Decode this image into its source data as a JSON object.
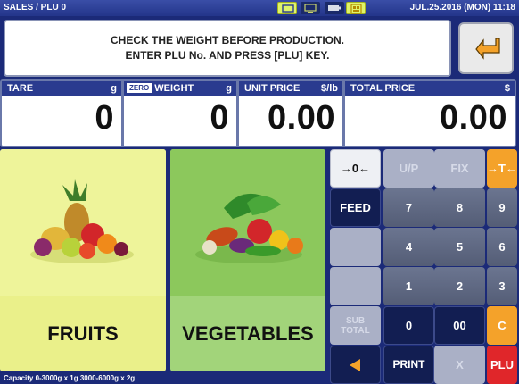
{
  "topbar": {
    "mode": "SALES / PLU 0",
    "datetime": "JUL.25.2016 (MON) 11:18",
    "status_icons": [
      "display-mode-icon",
      "monitor-icon",
      "battery-icon",
      "keypad-icon"
    ]
  },
  "message": {
    "line1": "CHECK THE WEIGHT BEFORE PRODUCTION.",
    "line2": "ENTER PLU No. AND PRESS [PLU] KEY."
  },
  "display": {
    "tare": {
      "label": "TARE",
      "unit": "g",
      "value": "0"
    },
    "weight": {
      "badge": "ZERO",
      "label": "WEIGHT",
      "unit": "g",
      "value": "0"
    },
    "unit_price": {
      "label": "UNIT PRICE",
      "unit": "$/lb",
      "value": "0.00"
    },
    "total_price": {
      "label": "TOTAL PRICE",
      "unit": "$",
      "value": "0.00"
    }
  },
  "categories": {
    "fruits": "FRUITS",
    "vegetables": "VEGETABLES"
  },
  "keys": {
    "zero": "→0←",
    "up": "U/P",
    "fix": "FIX",
    "tare": "→T←",
    "feed": "FEED",
    "sub_total": "SUB TOTAL",
    "print": "PRINT",
    "x": "X",
    "plu": "PLU",
    "clear": "C",
    "n0": "0",
    "n00": "00",
    "n1": "1",
    "n2": "2",
    "n3": "3",
    "n4": "4",
    "n5": "5",
    "n6": "6",
    "n7": "7",
    "n8": "8",
    "n9": "9"
  },
  "footer": "Capacity 0-3000g x 1g  3000-6000g x 2g",
  "colors": {
    "background": "#1b2a78",
    "fruits_panel": "#eaf08a",
    "vegetables_panel": "#a2d47a",
    "orange_key": "#f4a22a",
    "red_key": "#e0262a"
  }
}
